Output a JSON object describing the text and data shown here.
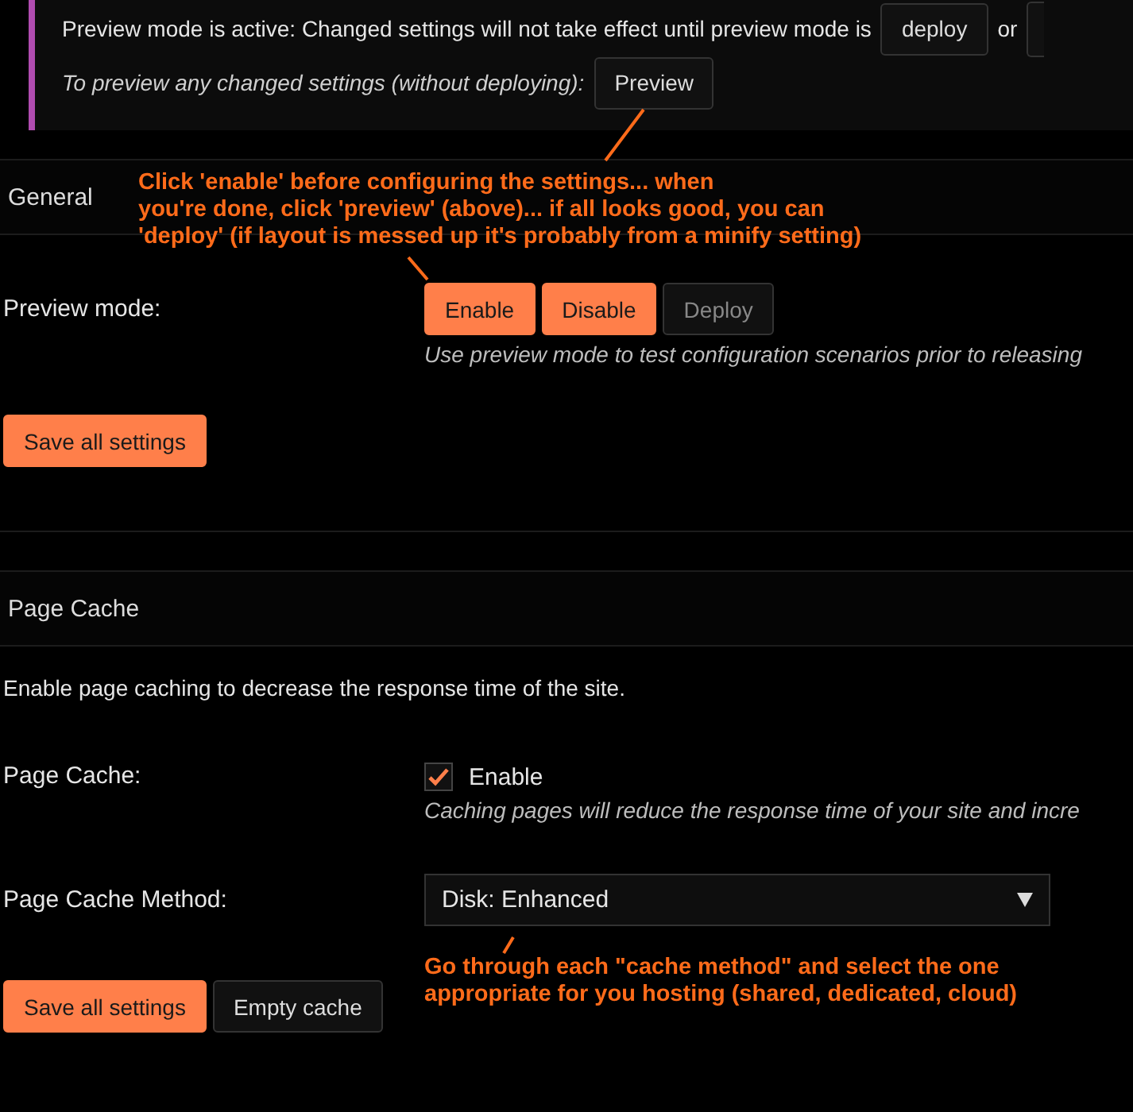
{
  "notice": {
    "message": "Preview mode is active: Changed settings will not take effect until preview mode is",
    "deploy_button": "deploy",
    "or_text": "or",
    "preview_hint": "To preview any changed settings (without deploying):",
    "preview_button": "Preview"
  },
  "general": {
    "title": "General",
    "preview_mode": {
      "label": "Preview mode:",
      "buttons": [
        {
          "label": "Enable",
          "kind": "primary",
          "disabled": false
        },
        {
          "label": "Disable",
          "kind": "primary",
          "disabled": false
        },
        {
          "label": "Deploy",
          "kind": "secondary",
          "disabled": true
        }
      ],
      "description": "Use preview mode to test configuration scenarios prior to releasing"
    },
    "save_button": "Save all settings"
  },
  "page_cache": {
    "title": "Page Cache",
    "intro": "Enable page caching to decrease the response time of the site.",
    "enable": {
      "label": "Page Cache:",
      "checkbox_label": "Enable",
      "checked": true,
      "description": "Caching pages will reduce the response time of your site and incre"
    },
    "method": {
      "label": "Page Cache Method:",
      "value": "Disk: Enhanced"
    },
    "buttons": [
      {
        "label": "Save all settings",
        "kind": "primary",
        "disabled": false
      },
      {
        "label": "Empty cache",
        "kind": "secondary",
        "disabled": false
      }
    ]
  },
  "annotations": [
    {
      "lines": [
        "Click 'enable' before configuring the settings... when",
        "you're done, click 'preview' (above)... if all looks good, you can",
        "'deploy' (if layout is messed up it's probably from a minify setting)"
      ]
    },
    {
      "lines": [
        "Go through each \"cache method\" and select the one",
        "appropriate for you hosting (shared, dedicated, cloud)"
      ]
    }
  ]
}
